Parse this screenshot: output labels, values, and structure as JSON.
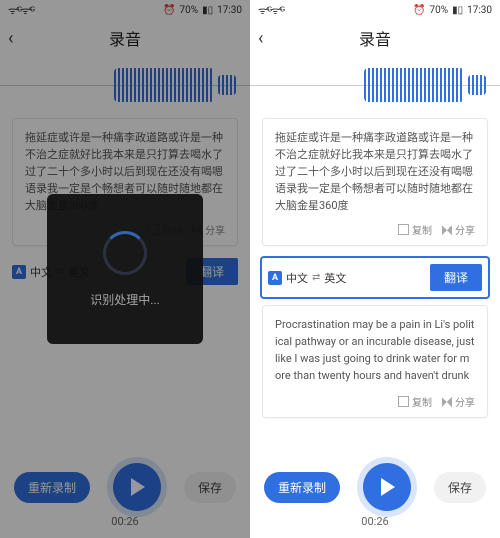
{
  "status": {
    "signal": "ᯤ ⁴ᴳ ᯤ ⁴ᴳ",
    "alarm": "⏰",
    "battery_pct": "70%",
    "battery_icon": "▮▯",
    "time": "17:30"
  },
  "nav": {
    "title": "录音",
    "back": "‹"
  },
  "transcript_zh": "拖延症或许是一种痛李政道路或许是一种不治之症就好比我本来是只打算去喝水了过了二十个多小时以后到现在还没有喝嗯语录我一定是个畅想者可以随时随地都在大脑金星360度",
  "transcript_en": "Procrastination may be a pain in Li's political pathway or an incurable disease, just like I was just going to drink water for more than twenty hours and haven't drunk any kid's words yet. I must be a visionary who can be",
  "actions": {
    "copy": "复制",
    "share": "分享"
  },
  "lang": {
    "iconA": "A",
    "zh": "中文",
    "swap": "⇄",
    "en": "英文"
  },
  "buttons": {
    "translate": "翻译",
    "rerecord": "重新录制",
    "save": "保存"
  },
  "time_elapsed": "00:26",
  "loading": "识别处理中..."
}
